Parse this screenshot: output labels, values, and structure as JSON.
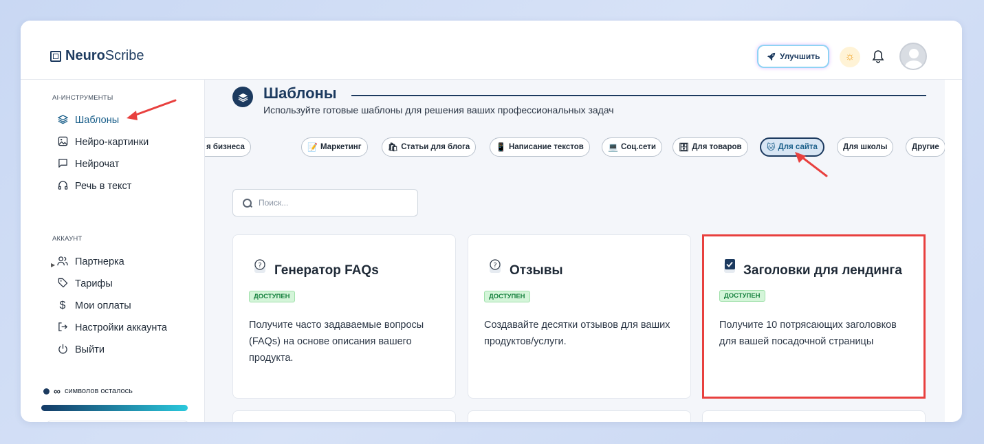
{
  "app": {
    "logo_bold": "Neuro",
    "logo_rest": "Scribe",
    "upgrade_label": "Улучшить"
  },
  "sidebar": {
    "sections": [
      {
        "label": "AI-ИНСТРУМЕНТЫ",
        "items": [
          {
            "label": "Шаблоны",
            "icon": "layers-icon",
            "active": true
          },
          {
            "label": "Нейро-картинки",
            "icon": "image-icon"
          },
          {
            "label": "Нейрочат",
            "icon": "chat-icon"
          },
          {
            "label": "Речь в текст",
            "icon": "headphones-icon"
          }
        ]
      },
      {
        "label": "АККАУНТ",
        "items": [
          {
            "label": "Партнерка",
            "icon": "users-icon"
          },
          {
            "label": "Тарифы",
            "icon": "tag-icon"
          },
          {
            "label": "Мои оплаты",
            "icon": "dollar-icon"
          },
          {
            "label": "Настройки аккаунта",
            "icon": "logout-arrow-icon"
          },
          {
            "label": "Выйти",
            "icon": "power-icon"
          }
        ]
      }
    ],
    "chars_symbol": "∞",
    "chars_text": "символов осталось"
  },
  "main": {
    "title": "Шаблоны",
    "subtitle": "Используйте готовые шаблоны для решения ваших профессиональных задач",
    "search_placeholder": "Поиск...",
    "categories": [
      {
        "label": "я бизнеса",
        "emoji": ""
      },
      {
        "label": "Маркетинг",
        "emoji": "📝"
      },
      {
        "label": "Статьи для блога",
        "emoji": "🛍"
      },
      {
        "label": "Написание текстов",
        "emoji": "📱"
      },
      {
        "label": "Соц.сети",
        "emoji": "💻"
      },
      {
        "label": "Для товаров",
        "emoji": "🗄"
      },
      {
        "label": "Для сайта",
        "emoji": "🐱",
        "active": true
      },
      {
        "label": "Для школы",
        "emoji": ""
      },
      {
        "label": "Другие",
        "emoji": ""
      }
    ],
    "cards": [
      {
        "title": "Генератор FAQs",
        "icon": "question-icon",
        "badge": "ДОСТУПЕН",
        "description": "Получите часто задаваемые вопросы (FAQs) на основе описания вашего продукта."
      },
      {
        "title": "Отзывы",
        "icon": "question-icon",
        "badge": "ДОСТУПЕН",
        "description": "Создавайте десятки отзывов для ваших продуктов/услуги."
      },
      {
        "title": "Заголовки для лендинга",
        "icon": "checkbox-icon",
        "badge": "ДОСТУПЕН",
        "description": "Получите 10 потрясающих заголовков для вашей посадочной страницы",
        "highlighted": true
      }
    ]
  },
  "colors": {
    "brand": "#1c3a5f",
    "accent": "#1a5f8a",
    "highlight": "#e8403e",
    "badge_bg": "#d4f5d9",
    "badge_text": "#15803d"
  }
}
